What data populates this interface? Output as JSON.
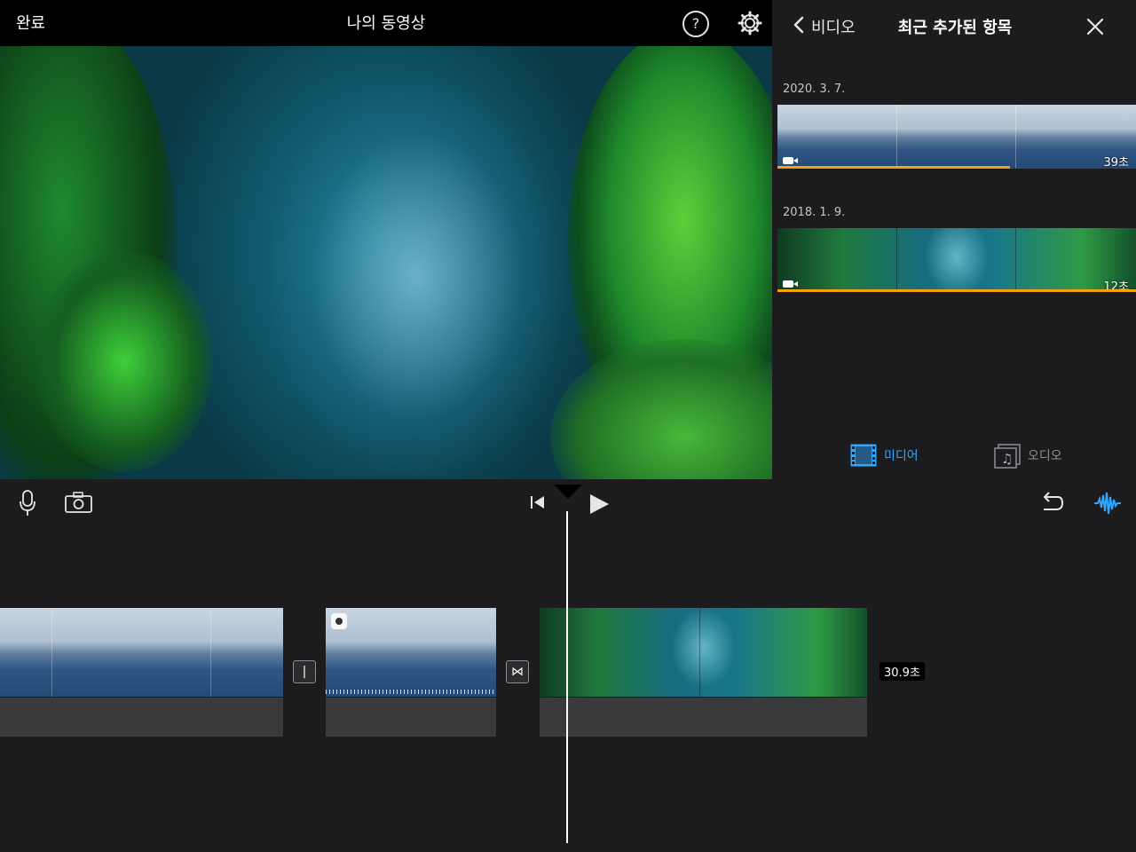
{
  "topbar": {
    "done_label": "완료",
    "project_title": "나의 동영상",
    "help_icon": "question-circle-icon",
    "settings_icon": "gear-icon"
  },
  "panel": {
    "back_label": "비디오",
    "title": "최근 추가된 항목",
    "groups": [
      {
        "date": "2020. 3. 7.",
        "duration": "39초",
        "thumb": "ocean-horizon"
      },
      {
        "date": "2018. 1. 9.",
        "duration": "12초",
        "thumb": "kelp-forest"
      }
    ],
    "tabs": [
      {
        "label": "미디어",
        "icon": "film-icon",
        "active": true
      },
      {
        "label": "오디오",
        "icon": "music-note-icon",
        "active": false
      }
    ]
  },
  "timeline": {
    "clip_duration": "30.9초",
    "transition_1": "|",
    "transition_2": "⋈"
  },
  "colors": {
    "accent": "#2fa6ff",
    "progress": "#f5a30c",
    "bg": "#1c1c1e"
  }
}
